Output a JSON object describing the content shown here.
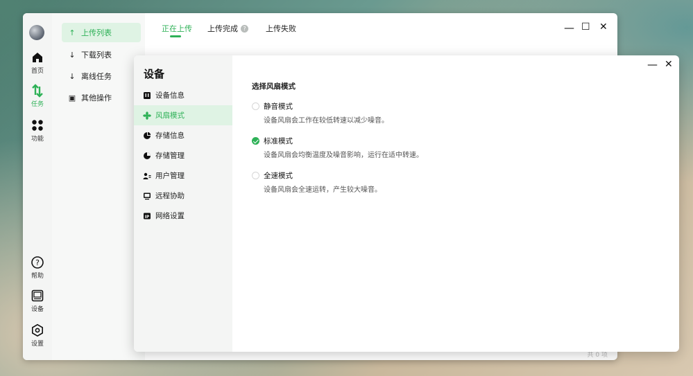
{
  "rail": {
    "items": [
      {
        "label": "首页",
        "icon": "home-icon"
      },
      {
        "label": "任务",
        "icon": "transfer-icon"
      },
      {
        "label": "功能",
        "icon": "apps-icon"
      },
      {
        "label": "帮助",
        "icon": "help-icon"
      },
      {
        "label": "设备",
        "icon": "device-icon"
      },
      {
        "label": "设置",
        "icon": "settings-icon"
      }
    ]
  },
  "nav2": {
    "items": [
      {
        "label": "上传列表",
        "arrow": "↑"
      },
      {
        "label": "下载列表",
        "arrow": "↓"
      },
      {
        "label": "离线任务",
        "arrow": "↓"
      },
      {
        "label": "其他操作",
        "arrow": "▣"
      }
    ]
  },
  "tabs": [
    {
      "label": "正在上传"
    },
    {
      "label": "上传完成",
      "help": "?"
    },
    {
      "label": "上传失败"
    }
  ],
  "window": {
    "minimize": "—",
    "maximize": "☐",
    "close": "✕",
    "footer": "共 0 项"
  },
  "dialog": {
    "title": "设备",
    "minimize": "—",
    "close": "✕",
    "items": [
      {
        "label": "设备信息"
      },
      {
        "label": "风扇模式"
      },
      {
        "label": "存储信息"
      },
      {
        "label": "存储管理"
      },
      {
        "label": "用户管理"
      },
      {
        "label": "远程协助"
      },
      {
        "label": "网络设置"
      }
    ],
    "section_title": "选择风扇模式",
    "options": [
      {
        "label": "静音模式",
        "desc": "设备风扇会工作在较低转速以减少噪音。",
        "checked": false
      },
      {
        "label": "标准模式",
        "desc": "设备风扇会均衡温度及噪音影响，运行在适中转速。",
        "checked": true
      },
      {
        "label": "全速模式",
        "desc": "设备风扇会全速运转，产生较大噪音。",
        "checked": false
      }
    ]
  },
  "colors": {
    "accent": "#2eb157",
    "active_bg": "#dff3e4"
  }
}
